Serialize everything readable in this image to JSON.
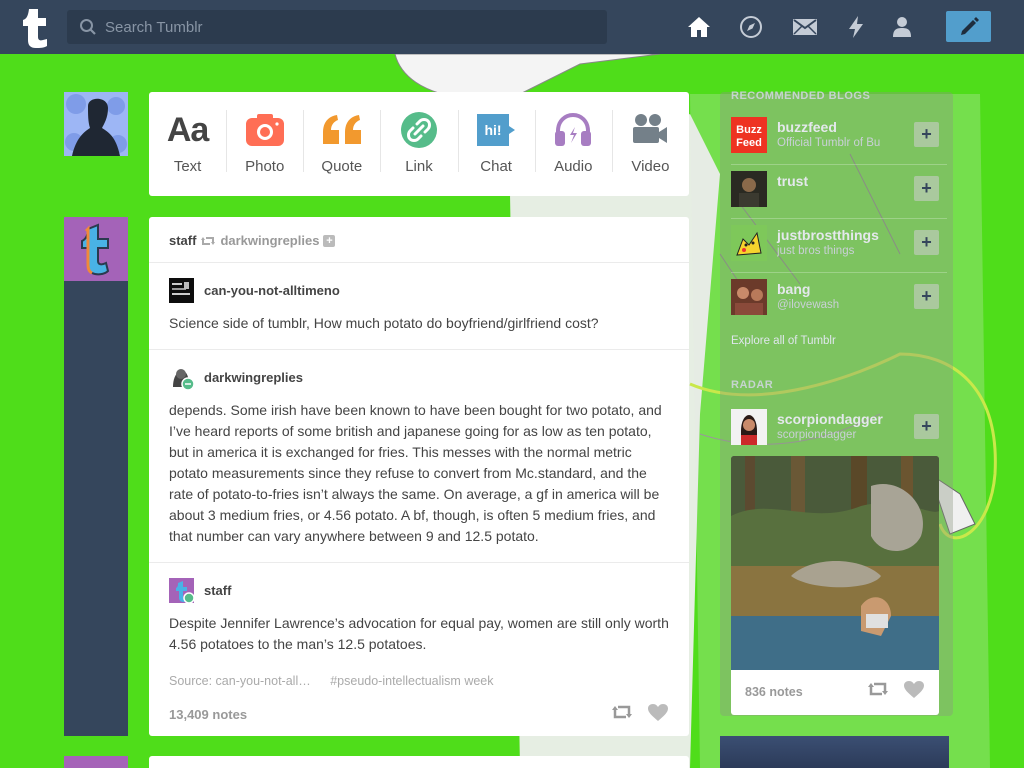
{
  "topbar": {
    "logo_icon": "tumblr-t-logo",
    "search_placeholder": "Search Tumblr",
    "nav_icons": [
      "home-icon",
      "explore-compass-icon",
      "inbox-mail-icon",
      "activity-lightning-icon",
      "account-person-icon"
    ],
    "compose_icon": "pencil-icon",
    "bg_color": "#35465c",
    "compose_color": "#529ecc"
  },
  "post_types": [
    {
      "label": "Text",
      "icon": "text-aa-icon",
      "color": "#444444"
    },
    {
      "label": "Photo",
      "icon": "camera-icon",
      "color": "#ff6e55"
    },
    {
      "label": "Quote",
      "icon": "quote-icon",
      "color": "#f2992e"
    },
    {
      "label": "Link",
      "icon": "link-icon",
      "color": "#56bc8a"
    },
    {
      "label": "Chat",
      "icon": "chat-bubble-icon",
      "color": "#529ecc"
    },
    {
      "label": "Audio",
      "icon": "headphones-icon",
      "color": "#a77dc2"
    },
    {
      "label": "Video",
      "icon": "video-camera-icon",
      "color": "#748089"
    }
  ],
  "post": {
    "reblogger": "staff",
    "reblogged_from": "darkwingreplies",
    "entries": [
      {
        "user": "can-you-not-alltimeno",
        "text": "Science side of tumblr, How much potato do boyfriend/girlfriend cost?"
      },
      {
        "user": "darkwingreplies",
        "text": "depends. Some irish have been known to have been bought for two potato, and I’ve heard reports of some british and japanese going for as low as ten potato, but in america it is exchanged for fries. This messes with the normal metric potato measurements since they refuse to convert from Mc.standard, and the rate of potato-to-fries isn’t always the same. On average, a gf in america will be about 3 medium fries, or 4.56 potato. A bf, though, is often 5 medium fries, and that number can vary anywhere between 9 and 12.5 potato."
      },
      {
        "user": "staff",
        "text": "Despite Jennifer Lawrence’s advocation for equal pay, women are still only worth 4.56 potatoes to the man’s 12.5 potatoes."
      }
    ],
    "source": "Source: can-you-not-all…",
    "tag": "#pseudo-intellectualism week",
    "notes": "13,409 notes"
  },
  "sidebar": {
    "recommended_heading": "RECOMMENDED BLOGS",
    "recommended": [
      {
        "name": "buzzfeed",
        "desc": "Official Tumblr of Bu"
      },
      {
        "name": "trust",
        "desc": ""
      },
      {
        "name": "justbrostthings",
        "desc": "just bros things"
      },
      {
        "name": "bang",
        "desc": "@ilovewash"
      }
    ],
    "explore_link": "Explore all of Tumblr",
    "radar_heading": "RADAR",
    "radar_blog": {
      "name": "scorpiondagger",
      "desc": "scorpiondagger"
    },
    "radar_notes": "836 notes",
    "follow_symbol": "+"
  }
}
